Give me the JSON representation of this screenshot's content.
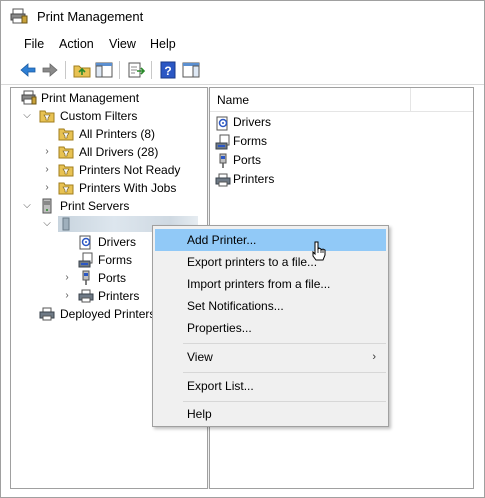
{
  "window": {
    "title": "Print Management"
  },
  "menubar": {
    "items": [
      "File",
      "Action",
      "View",
      "Help"
    ]
  },
  "toolbar": {
    "buttons": [
      "back-arrow-icon",
      "forward-arrow-icon",
      "up-folder-icon",
      "show-hide-tree-icon",
      "export-list-icon",
      "help-icon",
      "action-pane-icon"
    ]
  },
  "tree": {
    "root": "Print Management",
    "custom_filters": "Custom Filters",
    "all_printers": "All Printers (8)",
    "all_drivers": "All Drivers (28)",
    "printers_not_ready": "Printers Not Ready",
    "printers_with_jobs": "Printers With Jobs",
    "print_servers": "Print Servers",
    "server_name": "",
    "drivers": "Drivers",
    "forms": "Forms",
    "ports": "Ports",
    "printers": "Printers",
    "deployed_printers": "Deployed Printers"
  },
  "list": {
    "column_name": "Name",
    "items": [
      "Drivers",
      "Forms",
      "Ports",
      "Printers"
    ]
  },
  "context_menu": {
    "add_printer": "Add Printer...",
    "export_printers": "Export printers to a file...",
    "import_printers": "Import printers from a file...",
    "set_notifications": "Set Notifications...",
    "properties": "Properties...",
    "view": "View",
    "export_list": "Export List...",
    "help": "Help"
  },
  "colors": {
    "highlight": "#91c9f7",
    "accent": "#1c6bc4",
    "folder": "#e8c253"
  }
}
